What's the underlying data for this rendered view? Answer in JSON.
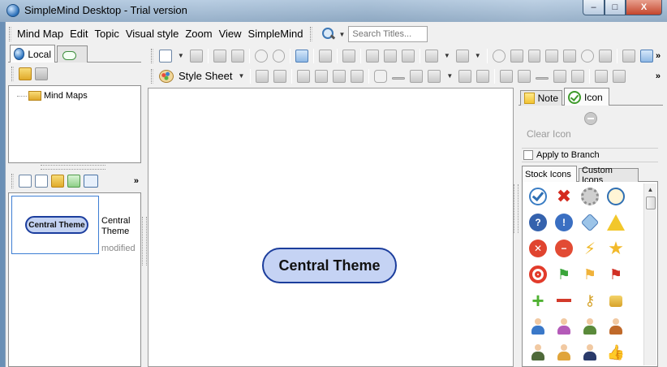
{
  "window": {
    "title": "SimpleMind Desktop - Trial version",
    "controls": {
      "minimize": "–",
      "maximize": "□",
      "close": "X"
    }
  },
  "menu": {
    "items": [
      "Mind Map",
      "Edit",
      "Topic",
      "Visual style",
      "Zoom",
      "View",
      "SimpleMind"
    ],
    "search_placeholder": "Search Titles..."
  },
  "left_panel": {
    "tabs": [
      {
        "label": "Local",
        "icon": "globe-icon"
      },
      {
        "label": "",
        "icon": "cloud-icon"
      }
    ],
    "tree": [
      {
        "label": "Mind Maps",
        "icon": "folder-icon"
      }
    ],
    "documents": [
      {
        "thumbnail_label": "Central Theme",
        "title": "Central Theme",
        "meta": "modified"
      }
    ]
  },
  "toolbar": {
    "style_sheet_label": "Style Sheet"
  },
  "canvas": {
    "central_topic": "Central Theme"
  },
  "right_panel": {
    "tabs": [
      {
        "label": "Note",
        "icon": "note-icon"
      },
      {
        "label": "Icon",
        "icon": "check-icon"
      }
    ],
    "clear_icon_label": "Clear Icon",
    "apply_to_branch_label": "Apply to Branch",
    "apply_to_branch_checked": false,
    "icon_tabs": [
      "Stock Icons",
      "Custom Icons"
    ],
    "stock_icons": [
      "check-icon",
      "cross-icon",
      "gear-icon",
      "clock-icon",
      "question-icon",
      "exclamation-icon",
      "diamond-info-icon",
      "warning-icon",
      "red-x-icon",
      "minus-icon",
      "lightning-icon",
      "star-icon",
      "target-icon",
      "green-flag-icon",
      "yellow-flag-icon",
      "red-flag-icon",
      "plus-icon",
      "dash-icon",
      "key-icon",
      "lock-icon",
      "person-blue-icon",
      "person-purple-icon",
      "people-icon",
      "person-briefcase-icon",
      "soldier-icon",
      "worker-icon",
      "graduate-icon",
      "thumbs-up-icon"
    ]
  },
  "colors": {
    "node_fill": "#c5d3f4",
    "node_border": "#1b3d9c",
    "selection_border": "#3d7ed4"
  }
}
